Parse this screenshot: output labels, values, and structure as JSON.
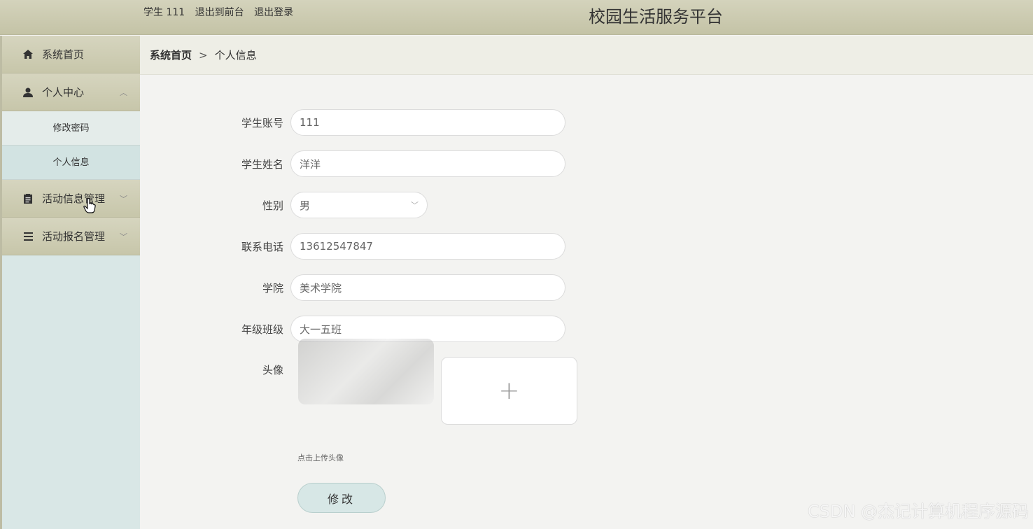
{
  "header": {
    "user_label": "学生 111",
    "link_front": "退出到前台",
    "link_logout": "退出登录",
    "site_title": "校园生活服务平台"
  },
  "sidebar": {
    "items": [
      {
        "label": "系统首页",
        "icon": "home-icon"
      },
      {
        "label": "个人中心",
        "icon": "user-icon",
        "expanded": true,
        "children": [
          {
            "label": "修改密码"
          },
          {
            "label": "个人信息"
          }
        ]
      },
      {
        "label": "活动信息管理",
        "icon": "clipboard-icon"
      },
      {
        "label": "活动报名管理",
        "icon": "list-icon"
      }
    ]
  },
  "breadcrumb": {
    "home": "系统首页",
    "separator": ">",
    "current": "个人信息"
  },
  "form": {
    "account_label": "学生账号",
    "account_value": "111",
    "name_label": "学生姓名",
    "name_value": "洋洋",
    "gender_label": "性别",
    "gender_value": "男",
    "phone_label": "联系电话",
    "phone_value": "13612547847",
    "college_label": "学院",
    "college_value": "美术学院",
    "class_label": "年级班级",
    "class_value": "大一五班",
    "avatar_label": "头像",
    "upload_plus": "+",
    "upload_tip": "点击上传头像",
    "submit_label": "修改"
  },
  "watermark": "CSDN @杰记计算机程序源码",
  "colors": {
    "header_bg": "#c9c8ab",
    "sidebar_bg": "#d9e7e6",
    "button_bg": "#d7e7e6"
  }
}
